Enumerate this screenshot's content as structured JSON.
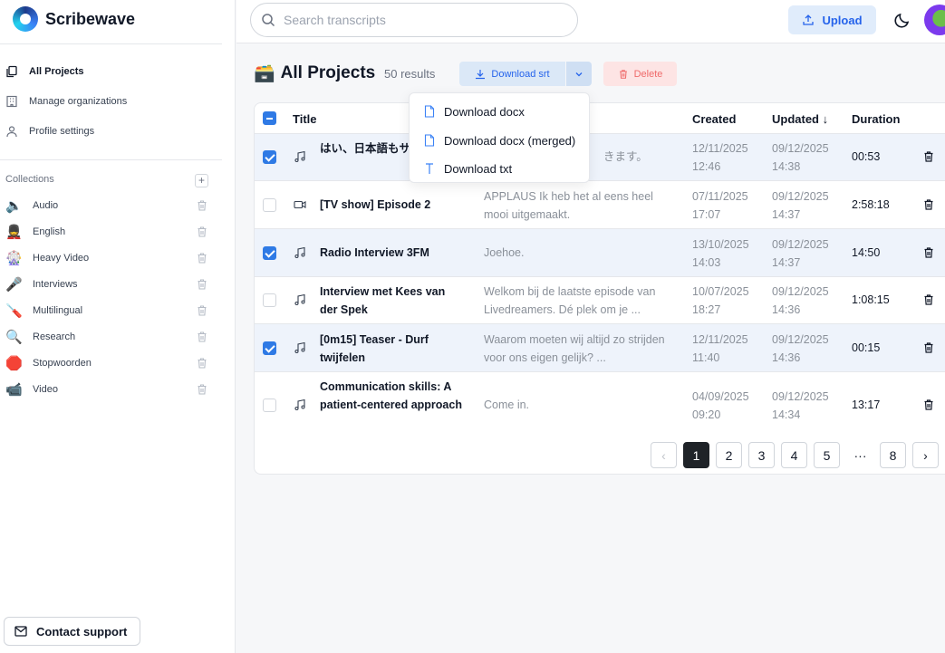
{
  "app": {
    "name": "Scribewave"
  },
  "sidebar": {
    "nav": [
      {
        "label": "All Projects",
        "icon": "file-copy-icon",
        "active": true
      },
      {
        "label": "Manage organizations",
        "icon": "building-icon",
        "active": false
      },
      {
        "label": "Profile settings",
        "icon": "user-icon",
        "active": false
      }
    ],
    "collections_label": "Collections",
    "add_label": "+",
    "collections": [
      {
        "emoji": "🔈",
        "label": "Audio"
      },
      {
        "emoji": "💂",
        "label": "English"
      },
      {
        "emoji": "🎡",
        "label": "Heavy Video"
      },
      {
        "emoji": "🎤",
        "label": "Interviews"
      },
      {
        "emoji": "🪛",
        "label": "Multilingual"
      },
      {
        "emoji": "🔍",
        "label": "Research"
      },
      {
        "emoji": "🛑",
        "label": "Stopwoorden"
      },
      {
        "emoji": "📹",
        "label": "Video"
      }
    ],
    "support_label": "Contact support"
  },
  "topbar": {
    "search_placeholder": "Search transcripts",
    "upload_label": "Upload"
  },
  "header": {
    "title_emoji": "🗃️",
    "title": "All Projects",
    "results": "50 results",
    "download_label": "Download srt",
    "delete_label": "Delete"
  },
  "dropdown": {
    "items": [
      {
        "label": "Download docx",
        "icon": "document-icon"
      },
      {
        "label": "Download docx (merged)",
        "icon": "document-icon"
      },
      {
        "label": "Download txt",
        "icon": "text-icon"
      }
    ]
  },
  "table": {
    "columns": {
      "title": "Title",
      "created": "Created",
      "updated": "Updated ↓",
      "duration": "Duration"
    },
    "rows": [
      {
        "type": "audio",
        "selected": true,
        "title": "はい、日本語もサ ています",
        "preview": "きます。",
        "created_date": "12/11/2025",
        "created_time": "12:46",
        "updated_date": "09/12/2025",
        "updated_time": "14:38",
        "duration": "00:53"
      },
      {
        "type": "video",
        "selected": false,
        "title": "[TV show] Episode 2",
        "preview": "APPLAUS Ik heb het al eens heel mooi uitgemaakt.",
        "created_date": "07/11/2025",
        "created_time": "17:07",
        "updated_date": "09/12/2025",
        "updated_time": "14:37",
        "duration": "2:58:18"
      },
      {
        "type": "audio",
        "selected": true,
        "title": "Radio Interview 3FM",
        "preview": "Joehoe.",
        "created_date": "13/10/2025",
        "created_time": "14:03",
        "updated_date": "09/12/2025",
        "updated_time": "14:37",
        "duration": "14:50"
      },
      {
        "type": "audio",
        "selected": false,
        "title": "Interview met Kees van der Spek",
        "preview": "Welkom bij de laatste episode van Livedreamers. Dé plek om je ...",
        "created_date": "10/07/2025",
        "created_time": "18:27",
        "updated_date": "09/12/2025",
        "updated_time": "14:36",
        "duration": "1:08:15"
      },
      {
        "type": "audio",
        "selected": true,
        "title": "[0m15] Teaser - Durf twijfelen",
        "preview": "Waarom moeten wij altijd zo strijden voor ons eigen gelijk? ...",
        "created_date": "12/11/2025",
        "created_time": "11:40",
        "updated_date": "09/12/2025",
        "updated_time": "14:36",
        "duration": "00:15"
      },
      {
        "type": "audio",
        "selected": false,
        "title": "Communication skills: A patient-centered approach",
        "preview": "Come in.",
        "created_date": "04/09/2025",
        "created_time": "09:20",
        "updated_date": "09/12/2025",
        "updated_time": "14:34",
        "duration": "13:17"
      }
    ]
  },
  "pagination": {
    "prev": "‹",
    "pages": [
      "1",
      "2",
      "3",
      "4",
      "5"
    ],
    "ellipsis": "···",
    "last": "8",
    "next": "›",
    "current": "1"
  },
  "colors": {
    "accent": "#2563eb",
    "selected_row": "#eef3fb",
    "danger": "#ef6b6b"
  }
}
